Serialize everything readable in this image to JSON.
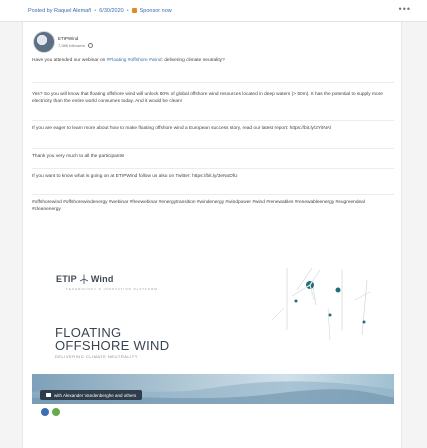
{
  "post_header": {
    "posted_by": "Posted by Raquel Alemañ",
    "date": "6/30/2020",
    "sponsor": "Sponsor now",
    "more": "•••"
  },
  "author": {
    "name": "ETIPWind",
    "sub": "7,086 followers"
  },
  "paragraphs": [
    {
      "text": "Have you attended our webinar on ",
      "tags": [
        "#Floating",
        "#offshore",
        "#wind"
      ],
      "tail": ": delivering climate neutrality?"
    },
    {
      "text": "Yes? So you will know that floating offshore wind will unlock 80% of global offshore wind resources located in deep waters (> 50m). It has the potential to supply more electricity than the entire world consumes today. And it would be clean!"
    },
    {
      "text": "If you are eager to learn more about how to make floating offshore wind a European success story, read our latest report: https://bit.ly/2YiINAl"
    },
    {
      "text": "Thank you very much to all the participants!"
    },
    {
      "text": "If you want to know what is going on at ETIPWind follow us also on Twitter: https://bit.ly/3eNoDfU"
    },
    {
      "text": "#offshorewind #offshorewindenergy #webinar #freewebinar #energytransition #windenergy #windpower #wind #renewables #renewableenergy #eugreendeal #cleanenergy"
    }
  ],
  "visual": {
    "logo_word_left": "ETIP",
    "logo_word_right": "Wind",
    "logo_sub": "TECHNOLOGY & INNOVATION PLATFORM",
    "headline_line1": "FLOATING",
    "headline_line2": "OFFSHORE WIND",
    "headline_sub": "DELIVERING CLIMATE NEUTRALITY",
    "banner_label": "with Alexander Vandenberghe and others"
  },
  "colors": {
    "link": "#3a6fb0",
    "headline": "#3a4552",
    "banner_pill": "#2f3c4a"
  }
}
